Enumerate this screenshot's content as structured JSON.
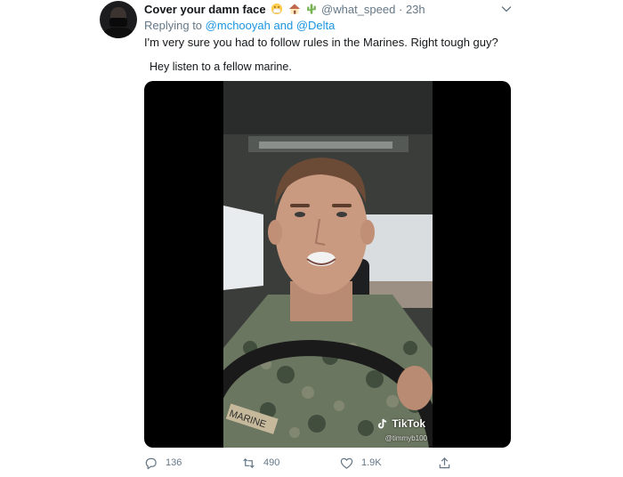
{
  "tweet": {
    "display_name": "Cover your damn face",
    "name_emojis": [
      "face-with-mask-emoji",
      "house-emoji",
      "cactus-emoji"
    ],
    "handle": "@what_speed",
    "separator": "·",
    "time": "23h",
    "replying_prefix": "Replying to",
    "reply_mention_1": "@mchooyah",
    "reply_joiner": "and",
    "reply_mention_2": "@Delta",
    "text": "I'm very sure you had to follow rules in the Marines. Right tough guy?",
    "media": {
      "caption": "Hey listen to a fellow marine.",
      "watermark_brand": "TikTok",
      "watermark_user": "@timmyb100"
    },
    "actions": {
      "reply_count": "136",
      "retweet_count": "490",
      "like_count": "1.9K"
    }
  },
  "colors": {
    "text": "#14171a",
    "secondary": "#657786",
    "link": "#1b95e0",
    "video_bg": "#000000"
  }
}
